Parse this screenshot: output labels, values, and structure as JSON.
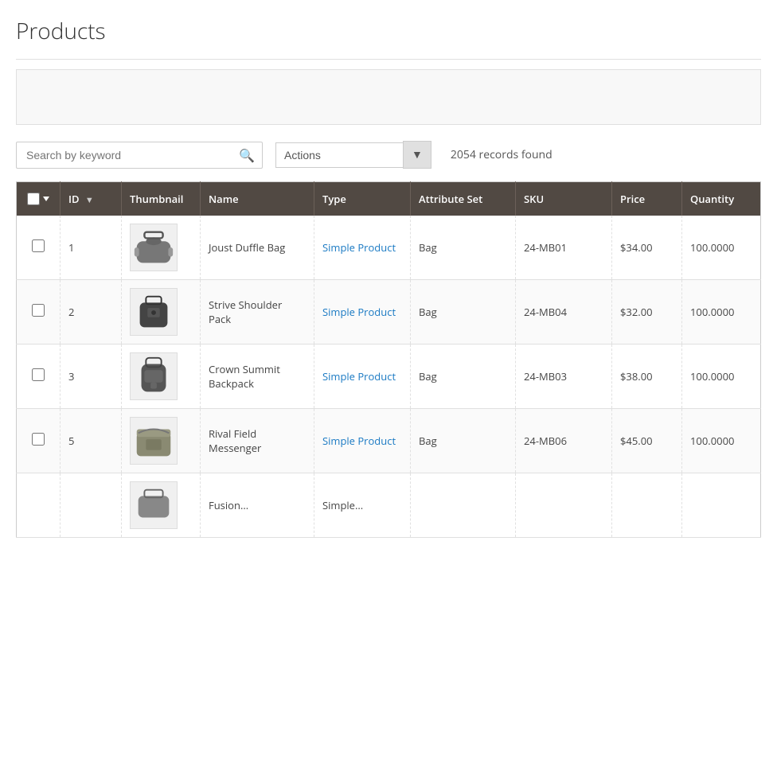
{
  "page": {
    "title": "Products"
  },
  "toolbar": {
    "search_placeholder": "Search by keyword",
    "search_icon": "🔍",
    "actions_label": "Actions",
    "records_count": "2054 records found"
  },
  "table": {
    "columns": [
      {
        "key": "checkbox",
        "label": ""
      },
      {
        "key": "id",
        "label": "ID"
      },
      {
        "key": "thumbnail",
        "label": "Thumbnail"
      },
      {
        "key": "name",
        "label": "Name"
      },
      {
        "key": "type",
        "label": "Type"
      },
      {
        "key": "attribute_set",
        "label": "Attribute Set"
      },
      {
        "key": "sku",
        "label": "SKU"
      },
      {
        "key": "price",
        "label": "Price"
      },
      {
        "key": "quantity",
        "label": "Quantity"
      }
    ],
    "rows": [
      {
        "id": "1",
        "name": "Joust Duffle Bag",
        "type": "Simple Product",
        "attribute_set": "Bag",
        "sku": "24-MB01",
        "price": "$34.00",
        "quantity": "100.0000",
        "thumb_shape": "duffle"
      },
      {
        "id": "2",
        "name": "Strive Shoulder Pack",
        "type": "Simple Product",
        "attribute_set": "Bag",
        "sku": "24-MB04",
        "price": "$32.00",
        "quantity": "100.0000",
        "thumb_shape": "shoulder"
      },
      {
        "id": "3",
        "name": "Crown Summit Backpack",
        "type": "Simple Product",
        "attribute_set": "Bag",
        "sku": "24-MB03",
        "price": "$38.00",
        "quantity": "100.0000",
        "thumb_shape": "backpack"
      },
      {
        "id": "5",
        "name": "Rival Field Messenger",
        "type": "Simple Product",
        "attribute_set": "Bag",
        "sku": "24-MB06",
        "price": "$45.00",
        "quantity": "100.0000",
        "thumb_shape": "messenger"
      },
      {
        "id": "",
        "name": "Fusion...",
        "type": "Simple...",
        "attribute_set": "",
        "sku": "",
        "price": "",
        "quantity": "",
        "thumb_shape": "fusion",
        "partial": true
      }
    ]
  }
}
